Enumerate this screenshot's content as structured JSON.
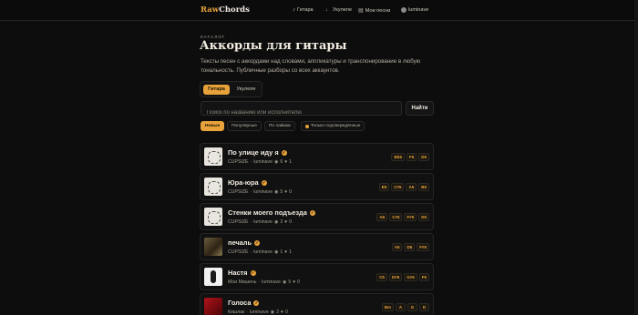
{
  "brand": {
    "part1": "Raw",
    "part2": "Chords"
  },
  "nav": {
    "guitar": "Гитара",
    "ukulele": "Укулеле",
    "my_songs": "Мои песни",
    "user": "luminave"
  },
  "header": {
    "kicker": "КАТАЛОГ",
    "title": "Аккорды для гитары",
    "description": "Тексты песен с аккордами над словами, аппликатуры и транспонирование в любую тональность. Публичные разборы со всех аккаунтов."
  },
  "instrument_tabs": [
    {
      "label": "Гитара",
      "active": true
    },
    {
      "label": "Укулеле",
      "active": false
    }
  ],
  "search": {
    "placeholder": "Поиск по названию или исполнителю",
    "value": "",
    "button_label": "Найти"
  },
  "filters": {
    "sort": [
      "Новые",
      "Популярные",
      "По лайкам"
    ],
    "active_sort": "Новые",
    "verified_label": "Только подтверждённые"
  },
  "colors": {
    "accent": "#e8a23a",
    "background": "#0d0d0d",
    "card": "#111111"
  },
  "songs": [
    {
      "title": "По улице иду я",
      "verified": true,
      "artist": "CUPSIZE",
      "author": "luminave",
      "views": "6",
      "likes": "1",
      "chords": [
        "Bb5",
        "F5",
        "D5"
      ],
      "thumb": "sketch"
    },
    {
      "title": "Юра-юра",
      "verified": true,
      "artist": "CUPSIZE",
      "author": "luminave",
      "views": "5",
      "likes": "0",
      "chords": [
        "E5",
        "C#5",
        "A5",
        "B5"
      ],
      "thumb": "sketch"
    },
    {
      "title": "Стенки моего подъезда",
      "verified": true,
      "artist": "CUPSIZE",
      "author": "luminave",
      "views": "2",
      "likes": "0",
      "chords": [
        "A5",
        "C#5",
        "F#5",
        "D5"
      ],
      "thumb": "sketch"
    },
    {
      "title": "печаль",
      "verified": true,
      "artist": "CUPSIZE",
      "author": "luminave",
      "views": "1",
      "likes": "1",
      "chords": [
        "A5",
        "D5",
        "F#5"
      ],
      "thumb": "dark1"
    },
    {
      "title": "Настя",
      "verified": true,
      "artist": "Мои Мишень",
      "author": "luminave",
      "views": "5",
      "likes": "0",
      "chords": [
        "C5",
        "D#5",
        "G#5",
        "F5"
      ],
      "thumb": "white"
    },
    {
      "title": "Голоса",
      "verified": true,
      "artist": "Кишлак",
      "author": "luminave",
      "views": "3",
      "likes": "0",
      "chords": [
        "Bm",
        "A",
        "G",
        "D"
      ],
      "thumb": "red"
    }
  ]
}
